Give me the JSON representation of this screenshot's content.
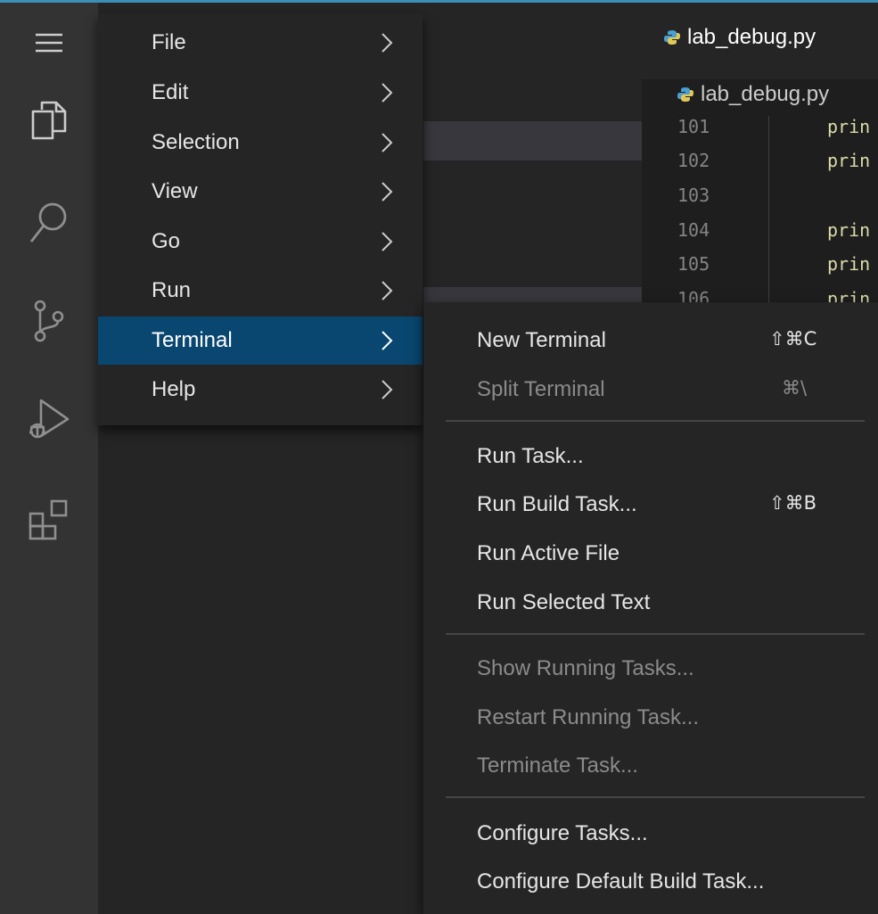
{
  "tab": {
    "filename": "lab_debug.py"
  },
  "breadcrumb": {
    "filename": "lab_debug.py"
  },
  "code_lines": [
    {
      "num": "101",
      "text": "prin"
    },
    {
      "num": "102",
      "text": "prin"
    },
    {
      "num": "103",
      "text": ""
    },
    {
      "num": "104",
      "text": "prin"
    },
    {
      "num": "105",
      "text": "prin"
    },
    {
      "num": "106",
      "text": "prin"
    }
  ],
  "main_menu": {
    "items": [
      {
        "label": "File"
      },
      {
        "label": "Edit"
      },
      {
        "label": "Selection"
      },
      {
        "label": "View"
      },
      {
        "label": "Go"
      },
      {
        "label": "Run"
      },
      {
        "label": "Terminal",
        "active": true
      },
      {
        "label": "Help"
      }
    ]
  },
  "terminal_menu": {
    "items": [
      {
        "label": "New Terminal",
        "shortcut": "⇧⌘C",
        "enabled": true
      },
      {
        "label": "Split Terminal",
        "shortcut": "⌘\\",
        "enabled": false
      },
      {
        "label": "Run Task...",
        "shortcut": "",
        "enabled": true
      },
      {
        "label": "Run Build Task...",
        "shortcut": "⇧⌘B",
        "enabled": true
      },
      {
        "label": "Run Active File",
        "shortcut": "",
        "enabled": true
      },
      {
        "label": "Run Selected Text",
        "shortcut": "",
        "enabled": true
      },
      {
        "label": "Show Running Tasks...",
        "shortcut": "",
        "enabled": false
      },
      {
        "label": "Restart Running Task...",
        "shortcut": "",
        "enabled": false
      },
      {
        "label": "Terminate Task...",
        "shortcut": "",
        "enabled": false
      },
      {
        "label": "Configure Tasks...",
        "shortcut": "",
        "enabled": true
      },
      {
        "label": "Configure Default Build Task...",
        "shortcut": "",
        "enabled": true
      }
    ]
  },
  "activity_bar": {
    "icons": [
      "menu-icon",
      "explorer-icon",
      "search-icon",
      "source-control-icon",
      "run-debug-icon",
      "extensions-icon"
    ]
  },
  "colors": {
    "accent_top": "#3b8fb7",
    "menu_active": "#094771",
    "menu_bg": "#252526",
    "activity_bg": "#333333"
  }
}
